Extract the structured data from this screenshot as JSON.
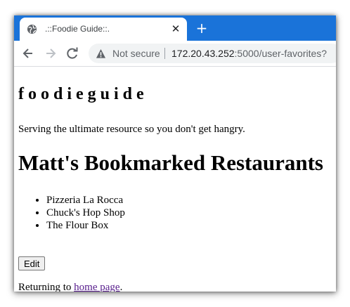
{
  "browser": {
    "tab_title": ".::Foodie Guide::.",
    "tab_close_glyph": "✕",
    "new_tab_glyph": "+",
    "security_label": "Not secure",
    "url_host": "172.20.43.252",
    "url_rest": ":5000/user-favorites?",
    "icons": [
      "globe-icon",
      "back-icon",
      "forward-icon",
      "reload-icon",
      "warning-icon"
    ],
    "accent_color": "#1a73d9"
  },
  "page": {
    "site_title": "f o o d i e g u i d e",
    "tagline": "Serving the ultimate resource so you don't get hangry.",
    "heading": "Matt's Bookmarked Restaurants",
    "favorites": [
      "Pizzeria La Rocca",
      "Chuck's Hop Shop",
      "The Flour Box"
    ],
    "edit_label": "Edit",
    "returning_prefix": "Returning to ",
    "home_link": "home page",
    "returning_suffix": "."
  }
}
